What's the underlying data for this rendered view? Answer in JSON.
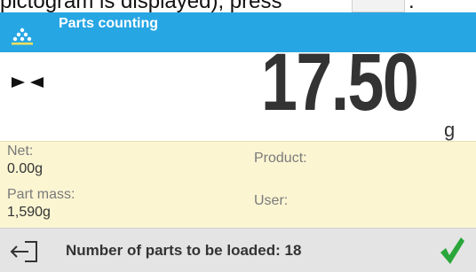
{
  "instruction_strip": {
    "text_before": "pictogram is displayed), press",
    "text_after": "."
  },
  "header": {
    "title": "Parts counting",
    "icon": "parts-counting-icon",
    "color": "#27a6e4"
  },
  "display": {
    "status_icon": "stable-indicator-icon",
    "value": "17.50",
    "unit": "g"
  },
  "info": {
    "net_label": "Net:",
    "net_value": "0.00g",
    "part_mass_label": "Part mass:",
    "part_mass_value": "1,590g",
    "product_label": "Product:",
    "product_value": "",
    "user_label": "User:",
    "user_value": ""
  },
  "footer": {
    "exit_icon": "exit-icon",
    "message": "Number of parts to be loaded: 18",
    "confirm_icon": "checkmark-icon",
    "confirm_color": "#2aa63a"
  }
}
